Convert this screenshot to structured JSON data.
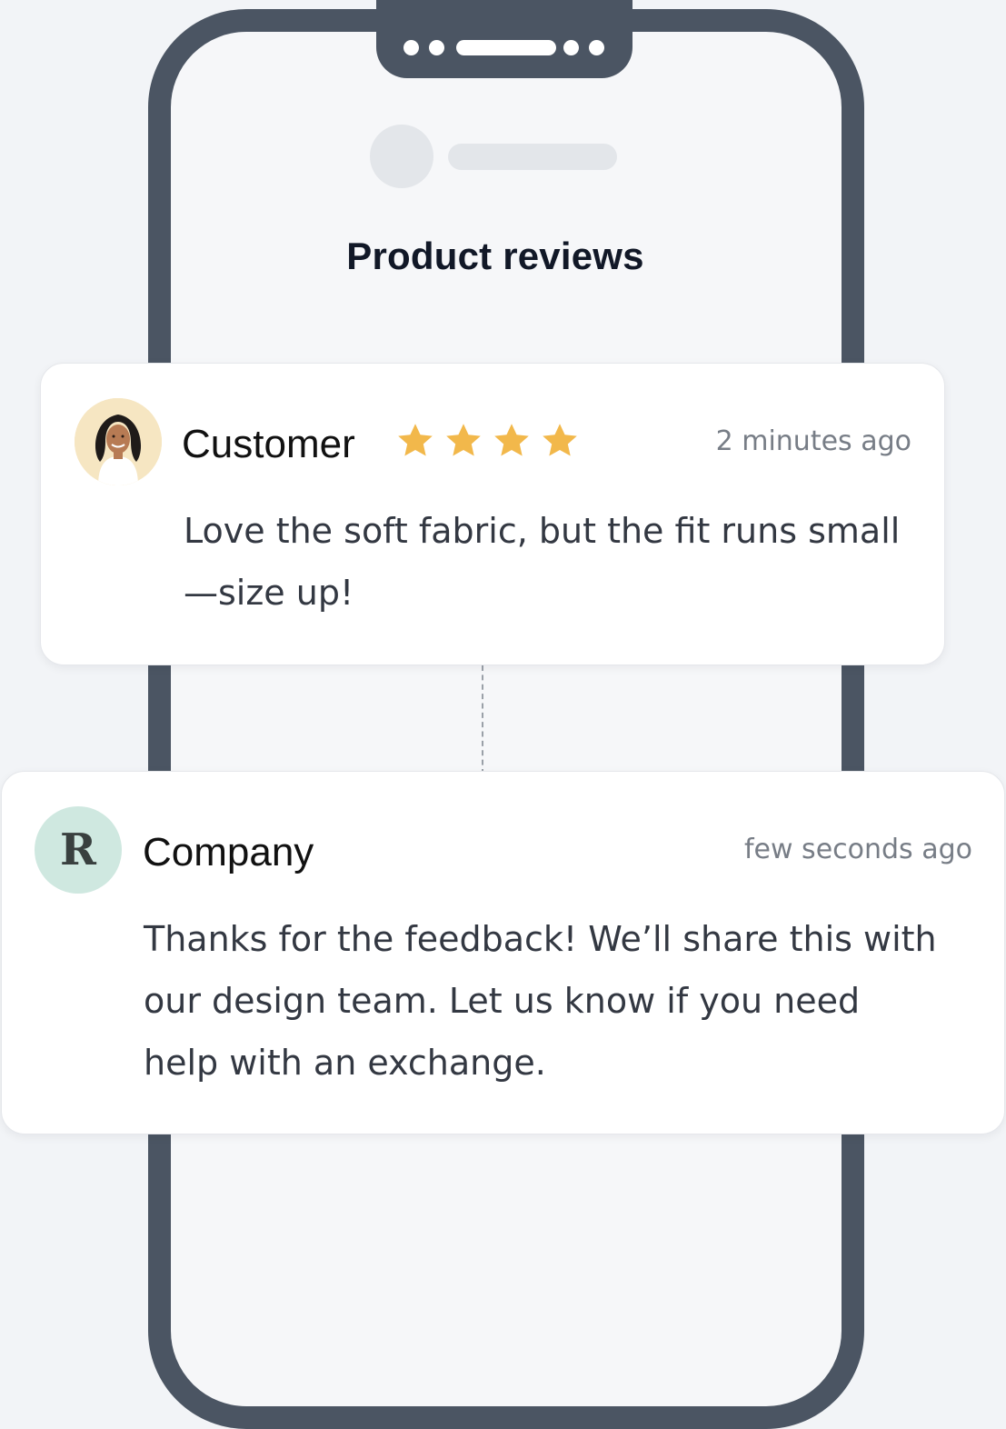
{
  "screen": {
    "title": "Product reviews"
  },
  "review": {
    "author": "Customer",
    "rating": 4,
    "rating_max": 4,
    "time": "2 minutes ago",
    "text": "Love the soft fabric, but the fit runs small—size up!",
    "avatar_icon": "woman-avatar-icon",
    "star_color": "#f2b84b"
  },
  "reply": {
    "author": "Company",
    "avatar_letter": "R",
    "time": "few seconds ago",
    "text": "Thanks for the feedback! We’ll share this with our design team. Let us know if you need help with an exchange."
  },
  "theme": {
    "phone_frame": "#4b5563",
    "screen_bg": "#f6f7f9",
    "company_avatar_bg": "#cfe8e0"
  }
}
